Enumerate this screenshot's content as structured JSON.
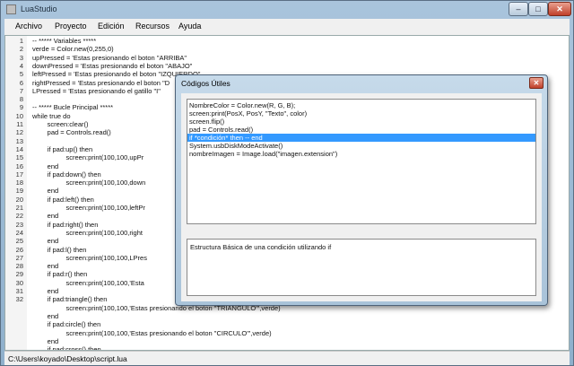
{
  "window": {
    "title": "LuaStudio"
  },
  "menu": [
    "Archivo",
    "Proyecto",
    "Edición",
    "Recursos",
    "Ayuda"
  ],
  "editor": {
    "line_numbers": [
      "1",
      "2",
      "3",
      "4",
      "5",
      "6",
      "7",
      "8",
      "9",
      "10",
      "11",
      "12",
      "13",
      "14",
      "15",
      "16",
      "17",
      "18",
      "19",
      "20",
      "21",
      "22",
      "23",
      "24",
      "25",
      "26",
      "27",
      "28",
      "29",
      "30",
      "31",
      "32"
    ],
    "lines": [
      "-- ***** Variables *****",
      "verde = Color.new(0,255,0)",
      "upPressed = 'Estas presionando el boton \"ARRIBA\"",
      "downPressed = 'Estas presionando el boton \"ABAJO\"",
      "leftPressed = 'Estas presionando el boton \"IZQUIERDO\"",
      "rightPressed = 'Estas presionando el boton \"D",
      "LPressed = 'Estas presionando el gatillo \"I\"",
      "",
      "-- ***** Bucle Principal *****",
      "while true do",
      "        screen:clear()",
      "        pad = Controls.read()",
      "",
      "        if pad:up() then",
      "                  screen:print(100,100,upPr",
      "        end",
      "        if pad:down() then",
      "                  screen:print(100,100,down",
      "        end",
      "        if pad:left() then",
      "                  screen:print(100,100,leftPr",
      "        end",
      "        if pad:right() then",
      "                  screen:print(100,100,right",
      "        end",
      "        if pad:l() then",
      "                  screen:print(100,100,LPres",
      "        end",
      "        if pad:r() then",
      "                  screen:print(100,100,'Esta",
      "        end",
      "        if pad:triangle() then",
      "                  screen:print(100,100,'Estas presionando el boton \"TRIANGULO\"',verde)",
      "        end",
      "        if pad:circle() then",
      "                  screen:print(100,100,'Estas presionando el boton \"CIRCULO\"',verde)",
      "        end",
      "        if pad:cross() then"
    ]
  },
  "status": {
    "path": "C:\\Users\\koyado\\Desktop\\script.lua"
  },
  "dialog": {
    "title": "Códigos Útiles",
    "snippets": [
      "NombreColor = Color.new(R, G, B);",
      "screen:print(PosX, PosY, \"Texto\", color)",
      "screen.flip()",
      "pad = Controls.read()",
      "if *condición* then -- end",
      "System.usbDiskModeActivate()",
      "nombreImagen = Image.load(\"imagen.extension\")"
    ],
    "selected_index": 4,
    "description": "Estructura Básica de una condición utilizando if"
  }
}
